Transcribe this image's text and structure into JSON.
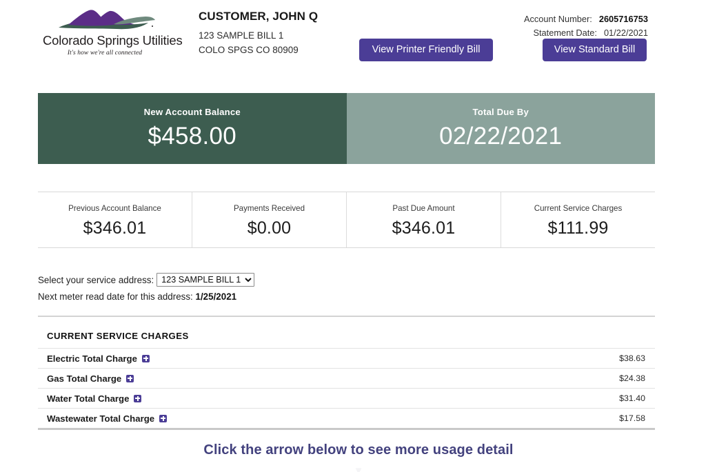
{
  "brand": {
    "wordmark": "Colorado Springs Utilities",
    "tagline": "It's how we're all connected",
    "logo_icon_name": "mountain-logo-icon",
    "purple": "#4b3d96",
    "dark_green": "#3d5d50",
    "light_green": "#8ba39c",
    "cta_purple": "#43427e"
  },
  "customer": {
    "name": "CUSTOMER, JOHN Q",
    "address_line1": "123 SAMPLE BILL 1",
    "address_line2": "COLO SPGS CO 80909"
  },
  "account": {
    "account_number_label": "Account Number:",
    "account_number_value": "2605716753",
    "statement_date_label": "Statement Date:",
    "statement_date_value": "01/22/2021"
  },
  "header_buttons": {
    "printer_friendly": "View Printer Friendly Bill",
    "standard_bill": "View Standard Bill"
  },
  "banner": {
    "left_label": "New Account Balance",
    "left_value": "$458.00",
    "right_label": "Total Due By",
    "right_value": "02/22/2021"
  },
  "summary": {
    "cells": [
      {
        "label": "Previous Account Balance",
        "value": "$346.01"
      },
      {
        "label": "Payments Received",
        "value": "$0.00"
      },
      {
        "label": "Past Due Amount",
        "value": "$346.01"
      },
      {
        "label": "Current Service Charges",
        "value": "$111.99"
      }
    ]
  },
  "service_address": {
    "select_label": "Select your service address:",
    "selected_option": "123 SAMPLE BILL 1",
    "options": [
      "123 SAMPLE BILL 1"
    ],
    "meter_label": "Next meter read date for this address:",
    "meter_value": "1/25/2021"
  },
  "charges": {
    "title": "CURRENT SERVICE CHARGES",
    "expand_icon_name": "plus-square-icon",
    "rows": [
      {
        "name": "Electric Total Charge",
        "amount": "$38.63"
      },
      {
        "name": "Gas Total Charge",
        "amount": "$24.38"
      },
      {
        "name": "Water Total Charge",
        "amount": "$31.40"
      },
      {
        "name": "Wastewater Total Charge",
        "amount": "$17.58"
      }
    ]
  },
  "footer": {
    "cta_text": "Click the arrow below to see more usage detail",
    "arrow_icon_name": "chevron-down-icon",
    "arrow_glyph": "▼"
  }
}
